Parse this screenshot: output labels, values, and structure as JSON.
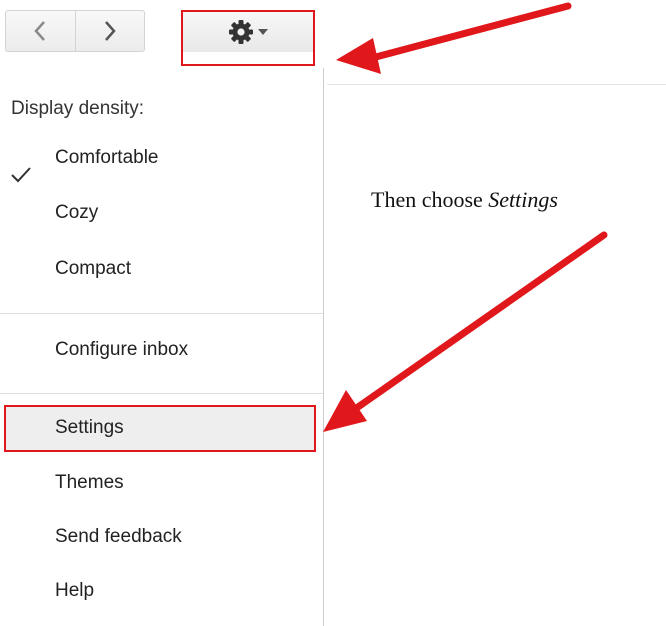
{
  "toolbar": {
    "back_icon": "chevron-left-icon",
    "forward_icon": "chevron-right-icon",
    "settings_icon": "gear-icon",
    "dropdown_icon": "caret-down-icon"
  },
  "menu": {
    "heading": "Display density:",
    "density_options": [
      {
        "label": "Comfortable",
        "checked": true
      },
      {
        "label": "Cozy",
        "checked": false
      },
      {
        "label": "Compact",
        "checked": false
      }
    ],
    "configure": "Configure inbox",
    "actions": [
      "Settings",
      "Themes",
      "Send feedback",
      "Help"
    ]
  },
  "annotation": {
    "prefix": "Then choose ",
    "emphasis": "Settings",
    "highlight_color": "#e0171b"
  }
}
